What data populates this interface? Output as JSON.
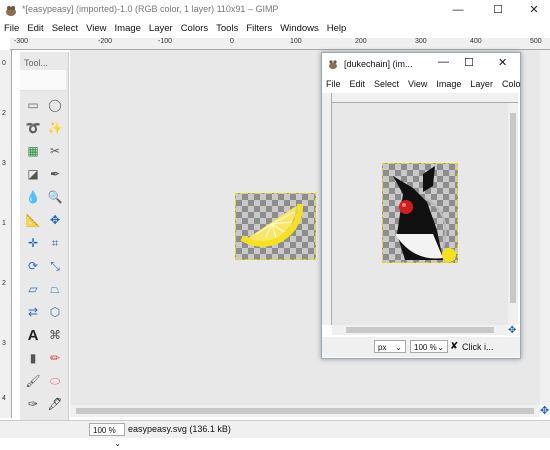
{
  "window": {
    "title": "*[easypeasy] (imported)-1.0 (RGB color, 1 layer) 110x91 – GIMP"
  },
  "menu": [
    "File",
    "Edit",
    "Select",
    "View",
    "Image",
    "Layer",
    "Colors",
    "Tools",
    "Filters",
    "Windows",
    "Help"
  ],
  "ruler": {
    "top": [
      "-300",
      "-200",
      "-100",
      "0",
      "100",
      "200",
      "300",
      "400",
      "500"
    ],
    "left": [
      "0",
      "2",
      "3",
      "1",
      "2",
      "3",
      "4"
    ]
  },
  "toolbox": {
    "title": "Tool..."
  },
  "tools": [
    "rect-select-icon",
    "ellipse-select-icon",
    "lasso-icon",
    "fuzzy-select-icon",
    "color-select-icon",
    "scissors-icon",
    "foreground-select-icon",
    "paths-icon",
    "color-picker-icon",
    "zoom-icon",
    "measure-icon",
    "move-icon",
    "align-icon",
    "crop-icon",
    "rotate-icon",
    "scale-icon",
    "shear-icon",
    "perspective-icon",
    "flip-icon",
    "cage-icon",
    "text-icon",
    "warp-icon",
    "blend-icon",
    "pencil-icon",
    "paintbrush-icon",
    "eraser-icon",
    "airbrush-icon",
    "ink-icon",
    "clone-icon",
    "smudge-icon"
  ],
  "duke": {
    "title": "[dukechain] (im...",
    "menu": [
      "File",
      "Edit",
      "Select",
      "View",
      "Image",
      "Layer",
      "Colo"
    ],
    "unit": "px",
    "zoom": "100 %",
    "status": "Click i..."
  },
  "status": {
    "zoom": "100 %",
    "file": "easypeasy.svg (136.1 kB)"
  },
  "colors": {
    "lemon": "#f7e11a",
    "duke_nose": "#d11d1d",
    "selection": "#e8d800"
  }
}
